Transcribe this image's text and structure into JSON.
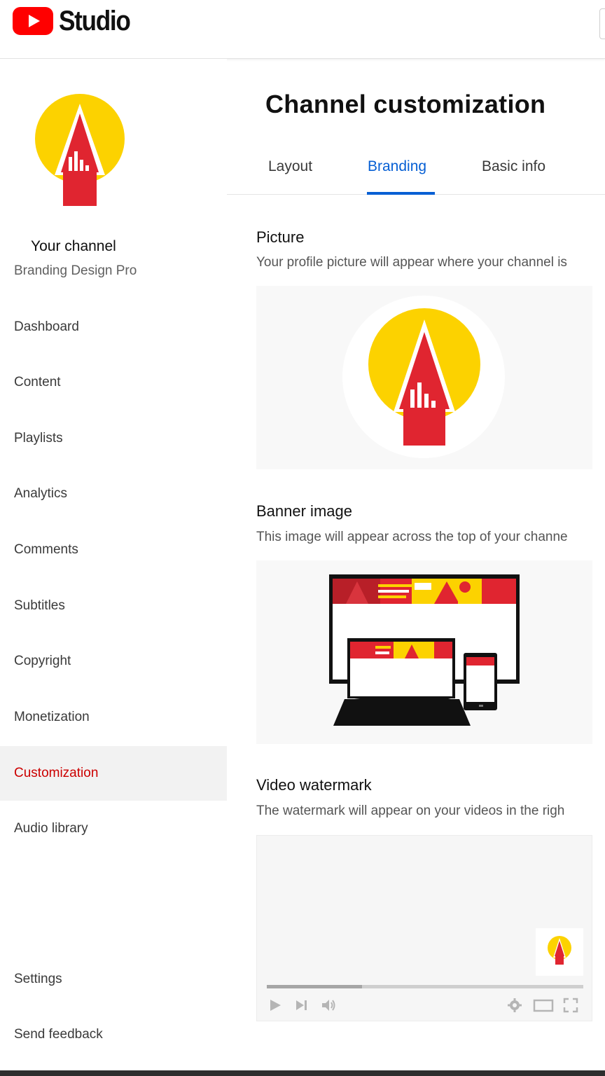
{
  "app": {
    "logo_text": "Studio"
  },
  "sidebar": {
    "channel_title": "Your channel",
    "channel_name": "Branding Design Pro",
    "items": [
      {
        "label": "Dashboard",
        "icon": "dashboard-icon"
      },
      {
        "label": "Content",
        "icon": "content-icon"
      },
      {
        "label": "Playlists",
        "icon": "playlists-icon"
      },
      {
        "label": "Analytics",
        "icon": "analytics-icon"
      },
      {
        "label": "Comments",
        "icon": "comments-icon"
      },
      {
        "label": "Subtitles",
        "icon": "subtitles-icon"
      },
      {
        "label": "Copyright",
        "icon": "copyright-icon"
      },
      {
        "label": "Monetization",
        "icon": "monetization-icon"
      },
      {
        "label": "Customization",
        "icon": "customization-icon",
        "active": true
      },
      {
        "label": "Audio library",
        "icon": "audio-library-icon"
      }
    ],
    "footer_items": [
      {
        "label": "Settings",
        "icon": "settings-icon"
      },
      {
        "label": "Send feedback",
        "icon": "feedback-icon"
      }
    ]
  },
  "main": {
    "title": "Channel customization",
    "tabs": [
      {
        "label": "Layout",
        "active": false
      },
      {
        "label": "Branding",
        "active": true
      },
      {
        "label": "Basic info",
        "active": false
      }
    ],
    "sections": {
      "picture": {
        "title": "Picture",
        "description": "Your profile picture will appear where your channel is"
      },
      "banner": {
        "title": "Banner image",
        "description": "This image will appear across the top of your channe"
      },
      "watermark": {
        "title": "Video watermark",
        "description": "The watermark will appear on your videos in the righ"
      }
    },
    "player": {
      "progress": 0.3,
      "controls": [
        "play-icon",
        "next-icon",
        "volume-icon",
        "settings-gear-icon",
        "theater-mode-icon",
        "fullscreen-icon"
      ]
    }
  },
  "colors": {
    "youtube_red": "#ff0000",
    "active_nav": "#cc0000",
    "active_tab": "#065fd4",
    "logo_yellow": "#fcd200",
    "logo_red": "#e02530"
  }
}
